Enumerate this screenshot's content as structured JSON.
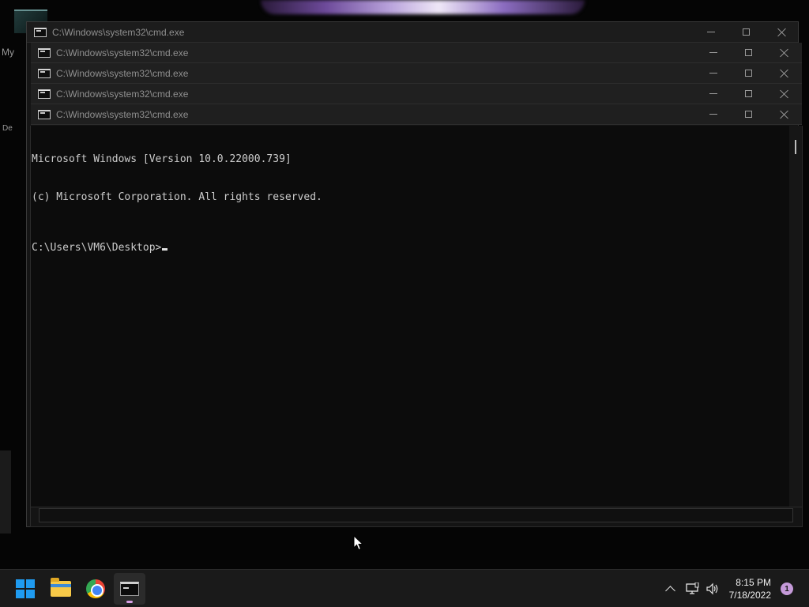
{
  "desktop": {
    "label_my": "My",
    "label_de": "De"
  },
  "windows": [
    {
      "title": "C:\\Windows\\system32\\cmd.exe"
    },
    {
      "title": "C:\\Windows\\system32\\cmd.exe"
    },
    {
      "title": "C:\\Windows\\system32\\cmd.exe"
    },
    {
      "title": "C:\\Windows\\system32\\cmd.exe"
    },
    {
      "title": "C:\\Windows\\system32\\cmd.exe"
    }
  ],
  "console": {
    "line1": "Microsoft Windows [Version 10.0.22000.739]",
    "line2": "(c) Microsoft Corporation. All rights reserved.",
    "prompt": "C:\\Users\\VM6\\Desktop>"
  },
  "taskbar": {
    "apps": [
      {
        "icon": "windows-start-icon"
      },
      {
        "icon": "file-explorer-icon"
      },
      {
        "icon": "chrome-icon"
      },
      {
        "icon": "command-prompt-icon",
        "active": true
      }
    ],
    "tray": {
      "icons": [
        "chevron-up-icon",
        "network-icon",
        "volume-icon"
      ]
    },
    "time": "8:15 PM",
    "date": "7/18/2022",
    "notification_count": "1"
  },
  "colors": {
    "console_bg": "#0c0c0c",
    "console_fg": "#cccccc",
    "titlebar_bg": "#202020",
    "taskbar_bg": "#1a1a1a",
    "start_blue": "#1f9bf0",
    "badge": "#c59ad9"
  }
}
